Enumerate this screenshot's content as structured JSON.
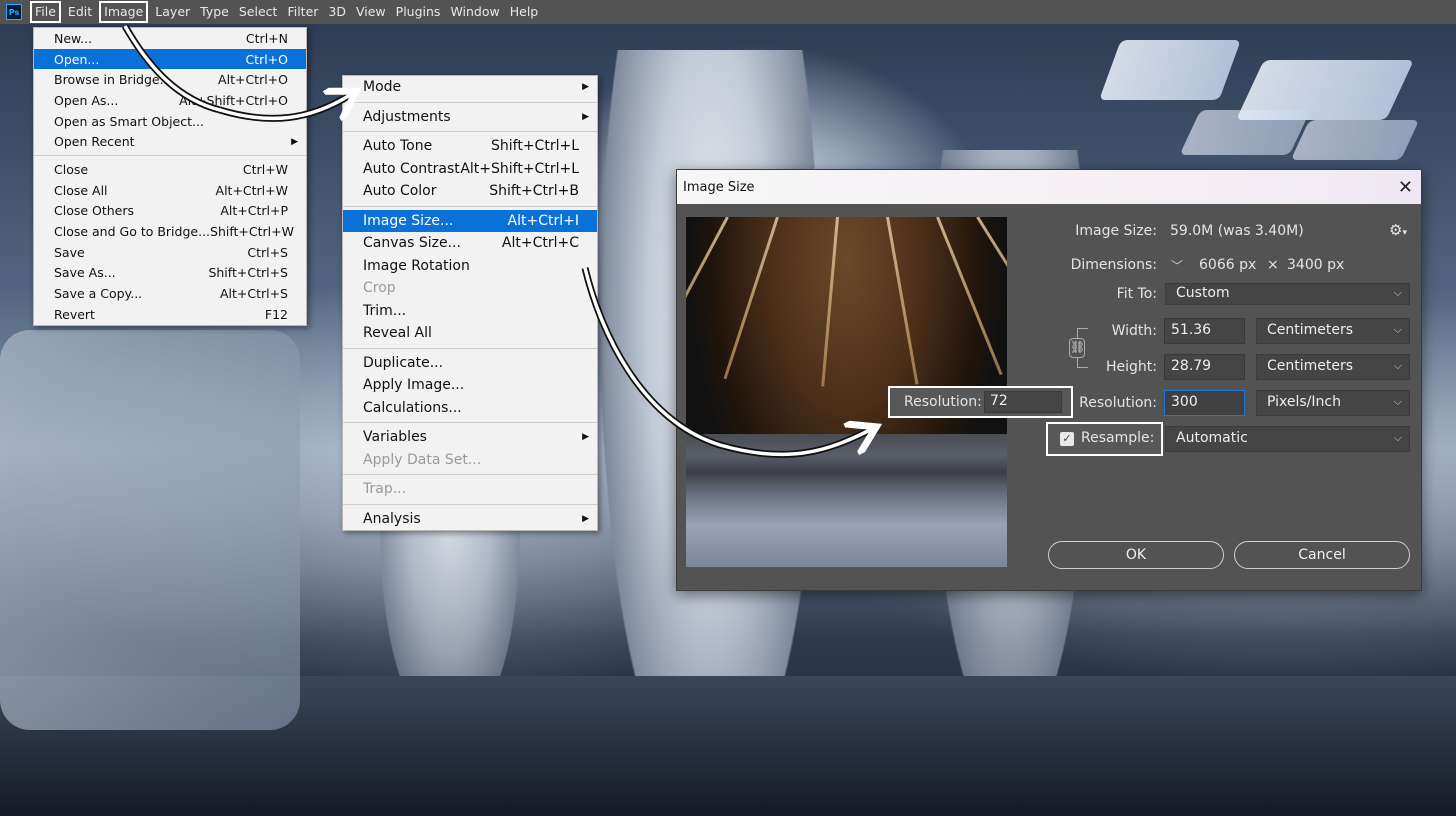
{
  "app": {
    "logo": "Ps"
  },
  "menubar": [
    "File",
    "Edit",
    "Image",
    "Layer",
    "Type",
    "Select",
    "Filter",
    "3D",
    "View",
    "Plugins",
    "Window",
    "Help"
  ],
  "file_menu": {
    "items": [
      {
        "label": "New...",
        "shortcut": "Ctrl+N"
      },
      {
        "label": "Open...",
        "shortcut": "Ctrl+O",
        "selected": true
      },
      {
        "label": "Browse in Bridge...",
        "shortcut": "Alt+Ctrl+O"
      },
      {
        "label": "Open As...",
        "shortcut": "Alt+Shift+Ctrl+O"
      },
      {
        "label": "Open as Smart Object...",
        "shortcut": ""
      },
      {
        "label": "Open Recent",
        "shortcut": "",
        "submenu": true
      },
      {
        "sep": true
      },
      {
        "label": "Close",
        "shortcut": "Ctrl+W"
      },
      {
        "label": "Close All",
        "shortcut": "Alt+Ctrl+W"
      },
      {
        "label": "Close Others",
        "shortcut": "Alt+Ctrl+P"
      },
      {
        "label": "Close and Go to Bridge...",
        "shortcut": "Shift+Ctrl+W"
      },
      {
        "label": "Save",
        "shortcut": "Ctrl+S"
      },
      {
        "label": "Save As...",
        "shortcut": "Shift+Ctrl+S"
      },
      {
        "label": "Save a Copy...",
        "shortcut": "Alt+Ctrl+S"
      },
      {
        "label": "Revert",
        "shortcut": "F12"
      }
    ]
  },
  "image_menu": {
    "items": [
      {
        "label": "Mode",
        "shortcut": "",
        "submenu": true
      },
      {
        "sep": true
      },
      {
        "label": "Adjustments",
        "shortcut": "",
        "submenu": true
      },
      {
        "sep": true
      },
      {
        "label": "Auto Tone",
        "shortcut": "Shift+Ctrl+L"
      },
      {
        "label": "Auto Contrast",
        "shortcut": "Alt+Shift+Ctrl+L"
      },
      {
        "label": "Auto Color",
        "shortcut": "Shift+Ctrl+B"
      },
      {
        "sep": true
      },
      {
        "label": "Image Size...",
        "shortcut": "Alt+Ctrl+I",
        "selected": true
      },
      {
        "label": "Canvas Size...",
        "shortcut": "Alt+Ctrl+C"
      },
      {
        "label": "Image Rotation",
        "shortcut": ""
      },
      {
        "label": "Crop",
        "shortcut": "",
        "disabled": true
      },
      {
        "label": "Trim...",
        "shortcut": ""
      },
      {
        "label": "Reveal All",
        "shortcut": ""
      },
      {
        "sep": true
      },
      {
        "label": "Duplicate...",
        "shortcut": ""
      },
      {
        "label": "Apply Image...",
        "shortcut": ""
      },
      {
        "label": "Calculations...",
        "shortcut": ""
      },
      {
        "sep": true
      },
      {
        "label": "Variables",
        "shortcut": "",
        "submenu": true
      },
      {
        "label": "Apply Data Set...",
        "shortcut": "",
        "disabled": true
      },
      {
        "sep": true
      },
      {
        "label": "Trap...",
        "shortcut": "",
        "disabled": true
      },
      {
        "sep": true
      },
      {
        "label": "Analysis",
        "shortcut": "",
        "submenu": true
      }
    ]
  },
  "dialog": {
    "title": "Image Size",
    "close": "✕",
    "image_size_label": "Image Size:",
    "image_size_value": "59.0M (was 3.40M)",
    "dimensions_label": "Dimensions:",
    "dimensions_w": "6066 px",
    "dimensions_x": "×",
    "dimensions_h": "3400 px",
    "fit_to_label": "Fit To:",
    "fit_to_value": "Custom",
    "width_label": "Width:",
    "width_value": "51.36",
    "width_unit": "Centimeters",
    "height_label": "Height:",
    "height_value": "28.79",
    "height_unit": "Centimeters",
    "resolution_label": "Resolution:",
    "resolution_value": "300",
    "resolution_unit": "Pixels/Inch",
    "resample_label": "Resample:",
    "resample_value": "Automatic",
    "ok_label": "OK",
    "cancel_label": "Cancel",
    "old_resolution_label": "Resolution:",
    "old_resolution_value": "72"
  },
  "icons": {
    "gear": "gear-icon",
    "link": "chain-link-icon",
    "check": "checkmark-icon",
    "chevron": "chevron-down-icon",
    "submenu": "submenu-arrow-icon"
  },
  "colors": {
    "menu_highlight": "#0a71d8",
    "menubar": "#535353",
    "dialog": "#535353",
    "focus": "#1f76d8"
  }
}
